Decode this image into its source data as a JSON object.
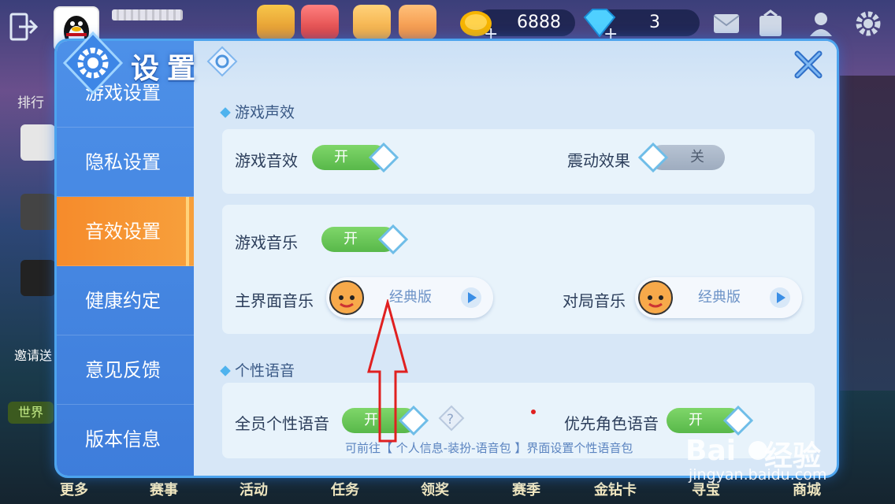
{
  "top": {
    "currency": [
      {
        "name": "gold",
        "value": "6888"
      },
      {
        "name": "diamond",
        "value": "3"
      }
    ],
    "top_icons": [
      "video-icon",
      "popcorn-icon",
      "gift-icon",
      "piggy-bank-icon"
    ]
  },
  "sidebar": {
    "rank_label": "排行",
    "invite": "邀请送",
    "world": "世界"
  },
  "bottom_tabs": [
    "更多",
    "赛事",
    "活动",
    "任务",
    "领奖",
    "赛季",
    "金钻卡",
    "寻宝",
    "商城"
  ],
  "panel": {
    "title": "设置",
    "nav": [
      {
        "label": "游戏设置",
        "active": false
      },
      {
        "label": "隐私设置",
        "active": false
      },
      {
        "label": "音效设置",
        "active": true
      },
      {
        "label": "健康约定",
        "active": false
      },
      {
        "label": "意见反馈",
        "active": false
      },
      {
        "label": "版本信息",
        "active": false
      }
    ],
    "sections": {
      "sound": {
        "title": "游戏声效",
        "game_sound": {
          "label": "游戏音效",
          "state": "开"
        },
        "vibration": {
          "label": "震动效果",
          "state": "关"
        }
      },
      "music": {
        "game_music": {
          "label": "游戏音乐",
          "state": "开"
        },
        "main_music": {
          "label": "主界面音乐",
          "value": "经典版"
        },
        "match_music": {
          "label": "对局音乐",
          "value": "经典版"
        }
      },
      "voice": {
        "title": "个性语音",
        "all_voice": {
          "label": "全员个性语音",
          "state": "开"
        },
        "priority_voice": {
          "label": "优先角色语音",
          "state": "开"
        },
        "hint": "可前往【 个人信息-装扮-语音包 】界面设置个性语音包"
      }
    }
  },
  "watermark": {
    "text": "经验",
    "url": "jingyan.baidu.com"
  },
  "colors": {
    "accent": "#4d90e8",
    "active_tab": "#f68b2b",
    "toggle_on": "#6cc95a",
    "annotation": "#e02020"
  }
}
